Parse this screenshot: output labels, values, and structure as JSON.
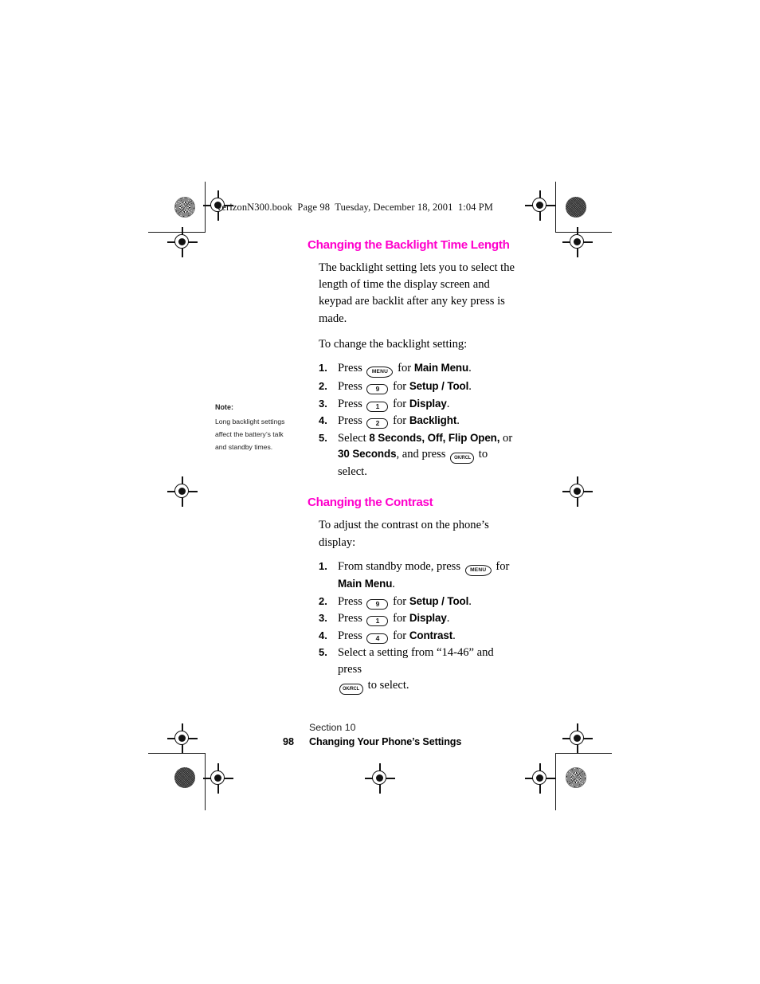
{
  "file_header": "verizonN300.book  Page 98  Tuesday, December 18, 2001  1:04 PM",
  "accent_color": "#ff00cc",
  "sections": [
    {
      "heading": "Changing the Backlight Time Length",
      "intro_paragraphs": [
        "The backlight setting lets you to select the length of time the display screen and keypad are backlit after any key press is made.",
        "To change the backlight setting:"
      ],
      "steps": [
        {
          "num": "1.",
          "pre": "Press",
          "key": "MENU",
          "mid": "for",
          "bold": "Main Menu",
          "post": "."
        },
        {
          "num": "2.",
          "pre": "Press",
          "key": "9",
          "mid": "for",
          "bold": "Setup / Tool",
          "post": "."
        },
        {
          "num": "3.",
          "pre": "Press",
          "key": "1",
          "mid": "for",
          "bold": "Display",
          "post": "."
        },
        {
          "num": "4.",
          "pre": "Press",
          "key": "2",
          "mid": "for",
          "bold": "Backlight",
          "post": "."
        },
        {
          "num": "5.",
          "pre": "Select",
          "bold": "8 Seconds, Off, Flip Open,",
          "mid2": "or",
          "bold2": "30 Seconds",
          "post2": ", and press",
          "key": "OK/RCL",
          "post": "to select."
        }
      ]
    },
    {
      "heading": "Changing the Contrast",
      "intro_paragraphs": [
        "To adjust the contrast on the phone’s display:"
      ],
      "steps": [
        {
          "num": "1.",
          "pre": "From standby mode, press",
          "key": "MENU",
          "mid": "for",
          "bold": "Main Menu",
          "post": "."
        },
        {
          "num": "2.",
          "pre": "Press",
          "key": "9",
          "mid": "for",
          "bold": "Setup / Tool",
          "post": "."
        },
        {
          "num": "3.",
          "pre": "Press",
          "key": "1",
          "mid": "for",
          "bold": "Display",
          "post": "."
        },
        {
          "num": "4.",
          "pre": "Press",
          "key": "4",
          "mid": "for",
          "bold": "Contrast",
          "post": "."
        },
        {
          "num": "5.",
          "pre": "Select a setting from “14-46” and press",
          "key": "OK/RCL",
          "post": "to select."
        }
      ]
    }
  ],
  "margin_note": {
    "label": "Note:",
    "text": "Long backlight settings affect the battery’s talk and standby times."
  },
  "footer": {
    "section": "Section 10",
    "page_number": "98",
    "title": "Changing Your Phone’s Settings"
  },
  "keys": {
    "menu_label": "MENU",
    "ok_label": "OK/RCL",
    "nine": "9",
    "one": "1",
    "two": "2",
    "four": "4"
  }
}
